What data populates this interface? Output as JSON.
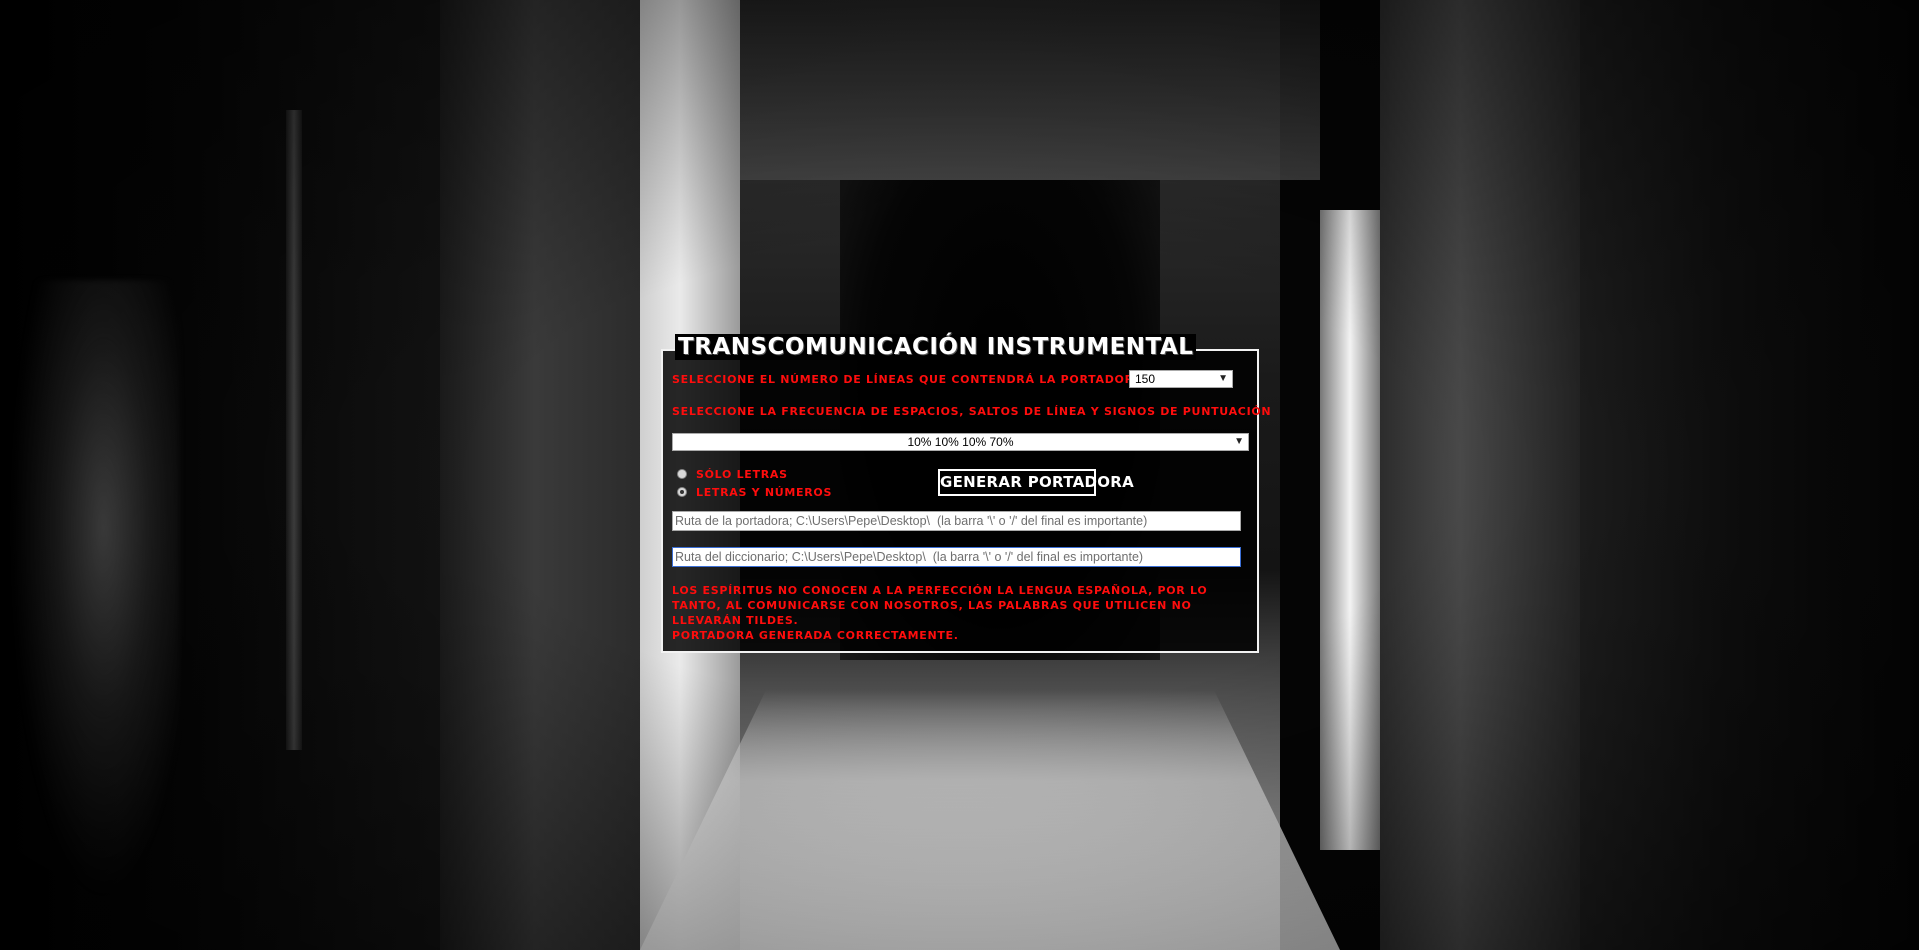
{
  "app": {
    "title": "Transcomunicación instrumental"
  },
  "form": {
    "lines_label": "Seleccione el número de líneas que contendrá la portadora",
    "lines_selected": "150",
    "frequency_label": "Seleccione la frecuencia de espacios, saltos de línea y signos de puntuación",
    "frequency_selected": "10% 10% 10% 70%",
    "radio_options": [
      {
        "label": "Sólo letras",
        "checked": false
      },
      {
        "label": "Letras y números",
        "checked": true
      }
    ],
    "generate_button": "Generar portadora",
    "carrier_path_placeholder": "Ruta de la portadora; C:\\Users\\Pepe\\Desktop\\  (la barra '\\' o '/' del final es importante)",
    "dictionary_path_placeholder": "Ruta del diccionario; C:\\Users\\Pepe\\Desktop\\  (la barra '\\' o '/' del final es importante)",
    "note": "Los espíritus no conocen a la perfección la lengua española, por lo tanto, al comunicarse con nosotros, las palabras que utilicen no llevarán tildes.",
    "status": "Portadora generada correctamente."
  },
  "icons": {
    "dropdown": "chevron-down-icon"
  },
  "colors": {
    "accent_red": "#ff0d0d",
    "panel_border": "#f2f2f2",
    "panel_background": "#000000"
  }
}
